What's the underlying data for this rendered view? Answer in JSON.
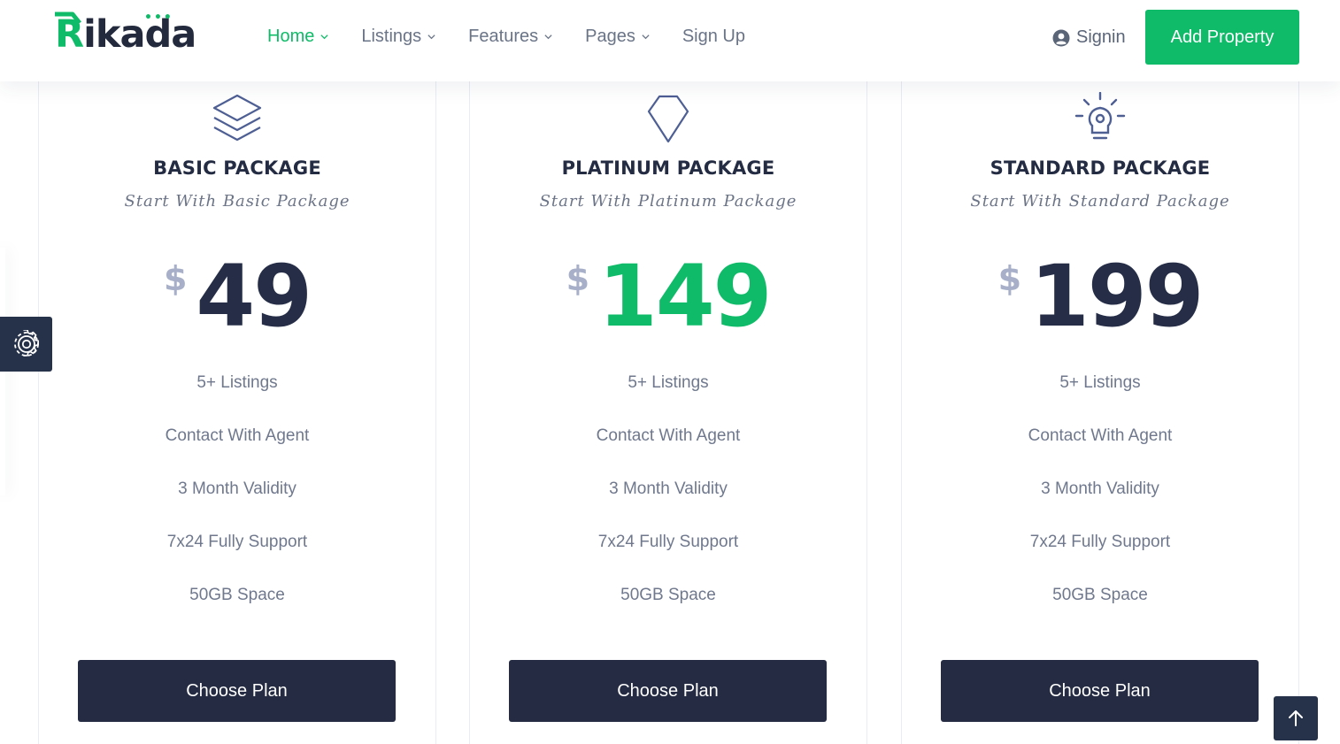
{
  "brand": {
    "name": "Rikada",
    "name_first": "R",
    "name_rest": "ikada",
    "accent_color": "#0fbb68",
    "dark_color": "#242b42"
  },
  "nav": {
    "items": [
      {
        "label": "Home",
        "dropdown": true,
        "active": true
      },
      {
        "label": "Listings",
        "dropdown": true,
        "active": false
      },
      {
        "label": "Features",
        "dropdown": true,
        "active": false
      },
      {
        "label": "Pages",
        "dropdown": true,
        "active": false
      },
      {
        "label": "Sign Up",
        "dropdown": false,
        "active": false
      }
    ],
    "signin_label": "Signin",
    "add_property_label": "Add Property"
  },
  "packages": [
    {
      "icon": "layers-icon",
      "title": "BASIC PACKAGE",
      "subtitle": "Start With Basic Package",
      "currency": "$",
      "price": "49",
      "featured": false,
      "features": [
        "5+ Listings",
        "Contact With Agent",
        "3 Month Validity",
        "7x24 Fully Support",
        "50GB Space"
      ],
      "button_label": "Choose Plan"
    },
    {
      "icon": "diamond-icon",
      "title": "PLATINUM PACKAGE",
      "subtitle": "Start With Platinum Package",
      "currency": "$",
      "price": "149",
      "featured": true,
      "features": [
        "5+ Listings",
        "Contact With Agent",
        "3 Month Validity",
        "7x24 Fully Support",
        "50GB Space"
      ],
      "button_label": "Choose Plan"
    },
    {
      "icon": "lightbulb-icon",
      "title": "STANDARD PACKAGE",
      "subtitle": "Start With Standard Package",
      "currency": "$",
      "price": "199",
      "featured": false,
      "features": [
        "5+ Listings",
        "Contact With Agent",
        "3 Month Validity",
        "7x24 Fully Support",
        "50GB Space"
      ],
      "button_label": "Choose Plan"
    }
  ],
  "floating": {
    "settings_icon": "gear-icon",
    "scroll_top_icon": "arrow-up-icon"
  }
}
